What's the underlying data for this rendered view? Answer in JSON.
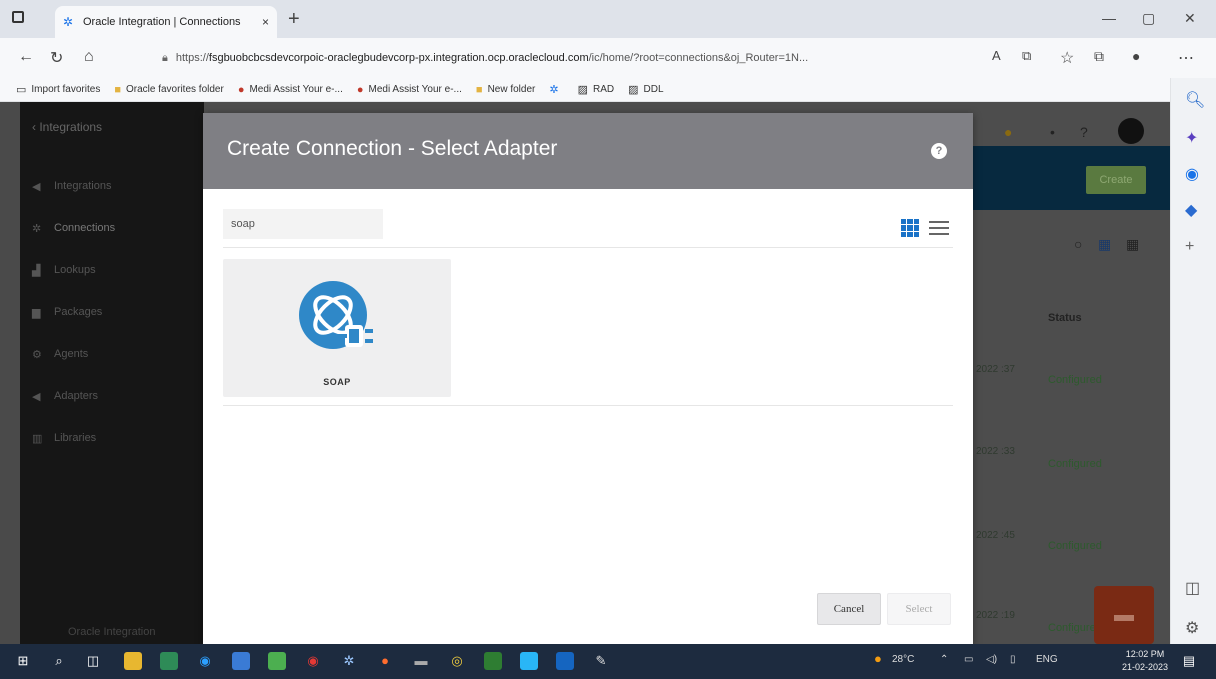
{
  "browser": {
    "tab_title": "Oracle Integration | Connections",
    "tab_close": "×",
    "new_tab": "+",
    "url_prefix": "https://",
    "url_host": "fsgbuobcbcsdevcorpoic-oraclegbudevcorp-px.integration.ocp.oraclecloud.com",
    "url_path": "/ic/home/?root=connections&oj_Router=1N...",
    "favorites": [
      {
        "label": "Import favorites",
        "icon": "import-icon"
      },
      {
        "label": "Oracle favorites folder",
        "icon": "folder-icon"
      },
      {
        "label": "Medi Assist Your e-...",
        "icon": "medi-assist-icon"
      },
      {
        "label": "Medi Assist Your e-...",
        "icon": "medi-assist-icon"
      },
      {
        "label": "New folder",
        "icon": "folder-icon"
      },
      {
        "label": "",
        "icon": "integration-icon"
      },
      {
        "label": "RAD",
        "icon": "image-icon"
      },
      {
        "label": "DDL",
        "icon": "image-icon"
      }
    ]
  },
  "app": {
    "back_label": "Integrations",
    "nav_items": [
      "Integrations",
      "Connections",
      "Lookups",
      "Packages",
      "Agents",
      "Adapters",
      "Libraries"
    ],
    "footer": "Oracle Integration",
    "create_label": "Create",
    "status_header": "Status",
    "rows": [
      {
        "date": "2022\n:37",
        "status": "Configured"
      },
      {
        "date": "2022\n:33",
        "status": "Configured"
      },
      {
        "date": "2022\n:45",
        "status": "Configured"
      },
      {
        "date": "2022\n:19",
        "status": "Configured"
      }
    ]
  },
  "modal": {
    "title": "Create Connection - Select Adapter",
    "help": "?",
    "search_value": "soap",
    "adapters": [
      {
        "label": "SOAP",
        "icon": "soap-adapter-icon"
      }
    ],
    "cancel_label": "Cancel",
    "select_label": "Select"
  },
  "taskbar": {
    "weather": "28°C",
    "lang": "ENG",
    "time": "12:02 PM",
    "date": "21-02-2023"
  },
  "colors": {
    "modal_header": "#7f7f84",
    "accent_blue": "#1a73c8",
    "soap_blue": "#2f88c8"
  }
}
